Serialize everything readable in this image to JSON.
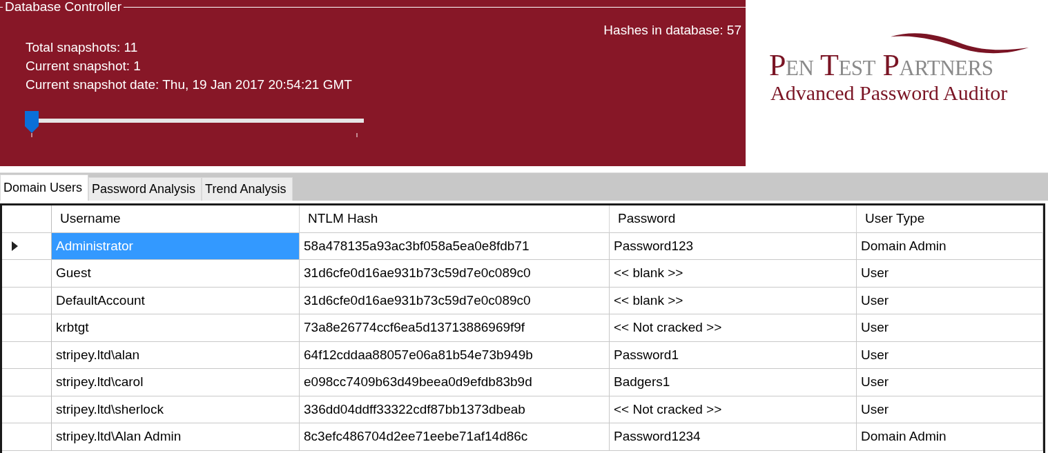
{
  "controller": {
    "title": "Database Controller",
    "hashes": "Hashes in database: 57",
    "lines": [
      "Total snapshots: 11",
      "Current snapshot: 1",
      "Current snapshot date: Thu, 19 Jan 2017 20:54:21 GMT"
    ],
    "slider": {
      "level": 0
    }
  },
  "logo": {
    "name": "Pen Test Partners",
    "product": "Advanced Password Auditor"
  },
  "tabs": [
    {
      "label": "Domain Users",
      "selected": true
    },
    {
      "label": "Password Analysis",
      "selected": false
    },
    {
      "label": "Trend Analysis",
      "selected": false
    }
  ],
  "table": {
    "columns": [
      "Username",
      "NTLM Hash",
      "Password",
      "User Type"
    ],
    "rows": [
      {
        "selected": true,
        "cells": [
          "Administrator",
          "58a478135a93ac3bf058a5ea0e8fdb71",
          "Password123",
          "Domain Admin"
        ]
      },
      {
        "selected": false,
        "cells": [
          "Guest",
          "31d6cfe0d16ae931b73c59d7e0c089c0",
          "<< blank >>",
          "User"
        ]
      },
      {
        "selected": false,
        "cells": [
          "DefaultAccount",
          "31d6cfe0d16ae931b73c59d7e0c089c0",
          "<< blank >>",
          "User"
        ]
      },
      {
        "selected": false,
        "cells": [
          "krbtgt",
          "73a8e26774ccf6ea5d13713886969f9f",
          "<< Not cracked >>",
          "User"
        ]
      },
      {
        "selected": false,
        "cells": [
          "stripey.ltd\\alan",
          "64f12cddaa88057e06a81b54e73b949b",
          "Password1",
          "User"
        ]
      },
      {
        "selected": false,
        "cells": [
          "stripey.ltd\\carol",
          "e098cc7409b63d49beea0d9efdb83b9d",
          "Badgers1",
          "User"
        ]
      },
      {
        "selected": false,
        "cells": [
          "stripey.ltd\\sherlock",
          "336dd04ddff33322cdf87bb1373dbeab",
          "<< Not cracked >>",
          "User"
        ]
      },
      {
        "selected": false,
        "cells": [
          "stripey.ltd\\Alan Admin",
          "8c3efc486704d2ee71eebe71af14d86c",
          "Password1234",
          "Domain Admin"
        ]
      }
    ]
  }
}
